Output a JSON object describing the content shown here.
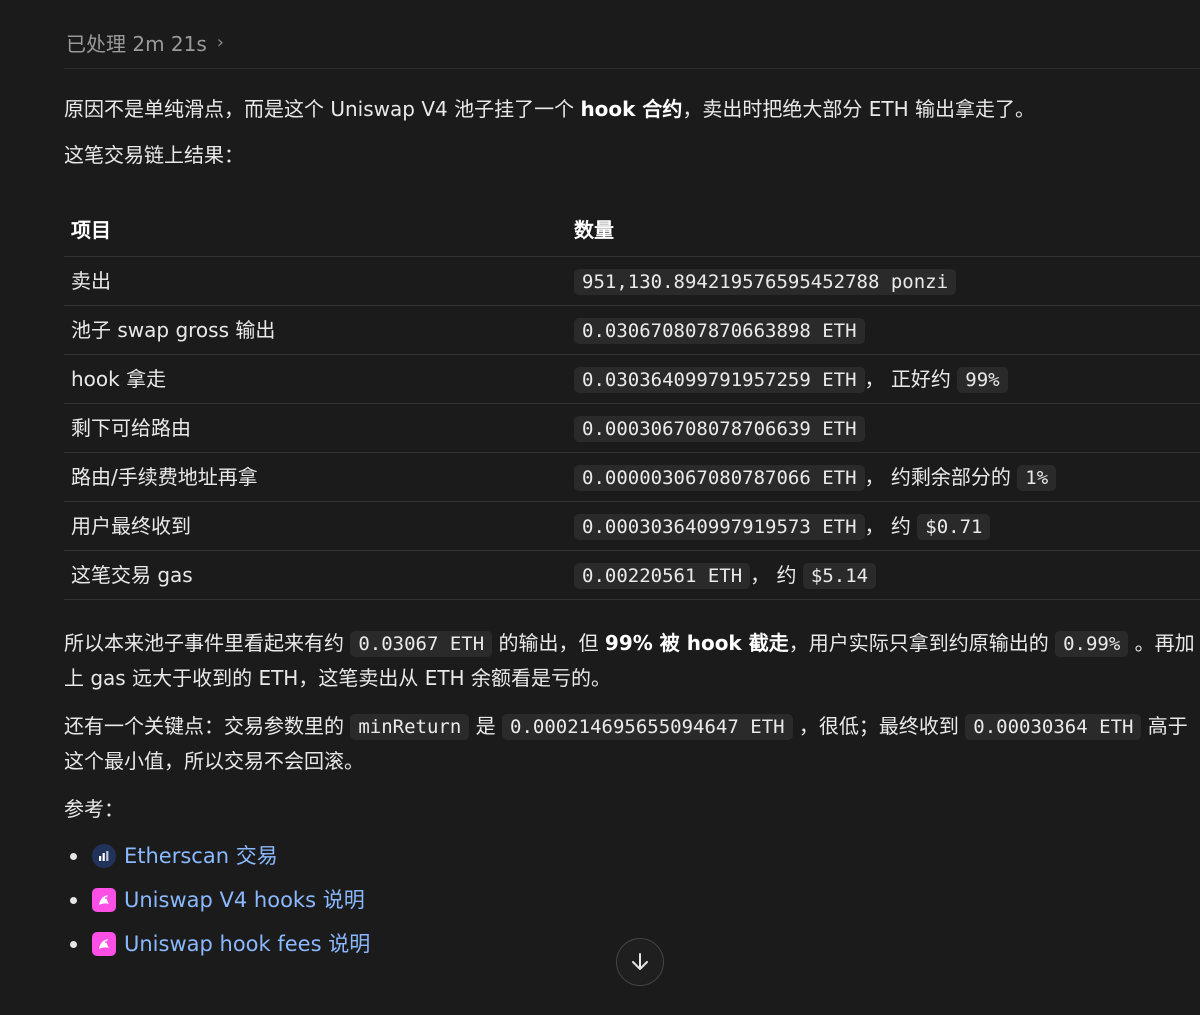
{
  "thinking": {
    "label": "已处理 2m 21s",
    "chevron": "chevron-right-icon"
  },
  "intro": {
    "before": "原因不是单纯滑点，而是这个 Uniswap V4 池子挂了一个 ",
    "bold": "hook 合约",
    "after": "，卖出时把绝大部分 ETH 输出拿走了。"
  },
  "subtitle": "这笔交易链上结果：",
  "table": {
    "headers": [
      "项目",
      "数量"
    ],
    "rows": [
      {
        "item": "卖出",
        "code": "951,130.894219576595452788 ponzi",
        "text": "",
        "code2": ""
      },
      {
        "item": "池子 swap gross 输出",
        "code": "0.030670807870663898 ETH",
        "text": "",
        "code2": ""
      },
      {
        "item": "hook 拿走",
        "code": "0.030364099791957259 ETH",
        "text": "， 正好约 ",
        "code2": "99%"
      },
      {
        "item": "剩下可给路由",
        "code": "0.000306708078706639 ETH",
        "text": "",
        "code2": ""
      },
      {
        "item": "路由/手续费地址再拿",
        "code": "0.000003067080787066 ETH",
        "text": "， 约剩余部分的 ",
        "code2": "1%"
      },
      {
        "item": "用户最终收到",
        "code": "0.000303640997919573 ETH",
        "text": "， 约 ",
        "code2": "$0.71"
      },
      {
        "item": "这笔交易 gas",
        "code": "0.00220561 ETH",
        "text": "， 约 ",
        "code2": "$5.14"
      }
    ]
  },
  "para1": {
    "t1": "所以本来池子事件里看起来有约 ",
    "c1": "0.03067 ETH",
    "t2": " 的输出，但 ",
    "b1": "99% 被 hook 截走",
    "t3": "，用户实际只拿到约原输出的 ",
    "c2": "0.99%",
    "t4": " 。再加上 gas 远大于收到的 ETH，这笔卖出从 ETH 余额看是亏的。"
  },
  "para2": {
    "t1": "还有一个关键点：交易参数里的 ",
    "c1": "minReturn",
    "t2": " 是 ",
    "c2": "0.000214695655094647 ETH",
    "t3": " ，很低；最终收到 ",
    "c3": "0.00030364 ETH",
    "t4": " 高于这个最小值，所以交易不会回滚。"
  },
  "refs": {
    "title": "参考：",
    "items": [
      {
        "label": "Etherscan 交易",
        "icon": "etherscan-icon"
      },
      {
        "label": "Uniswap V4 hooks 说明",
        "icon": "uniswap-icon"
      },
      {
        "label": "Uniswap hook fees 说明",
        "icon": "uniswap-icon"
      }
    ]
  },
  "scroll_button": {
    "icon": "arrow-down-icon"
  }
}
